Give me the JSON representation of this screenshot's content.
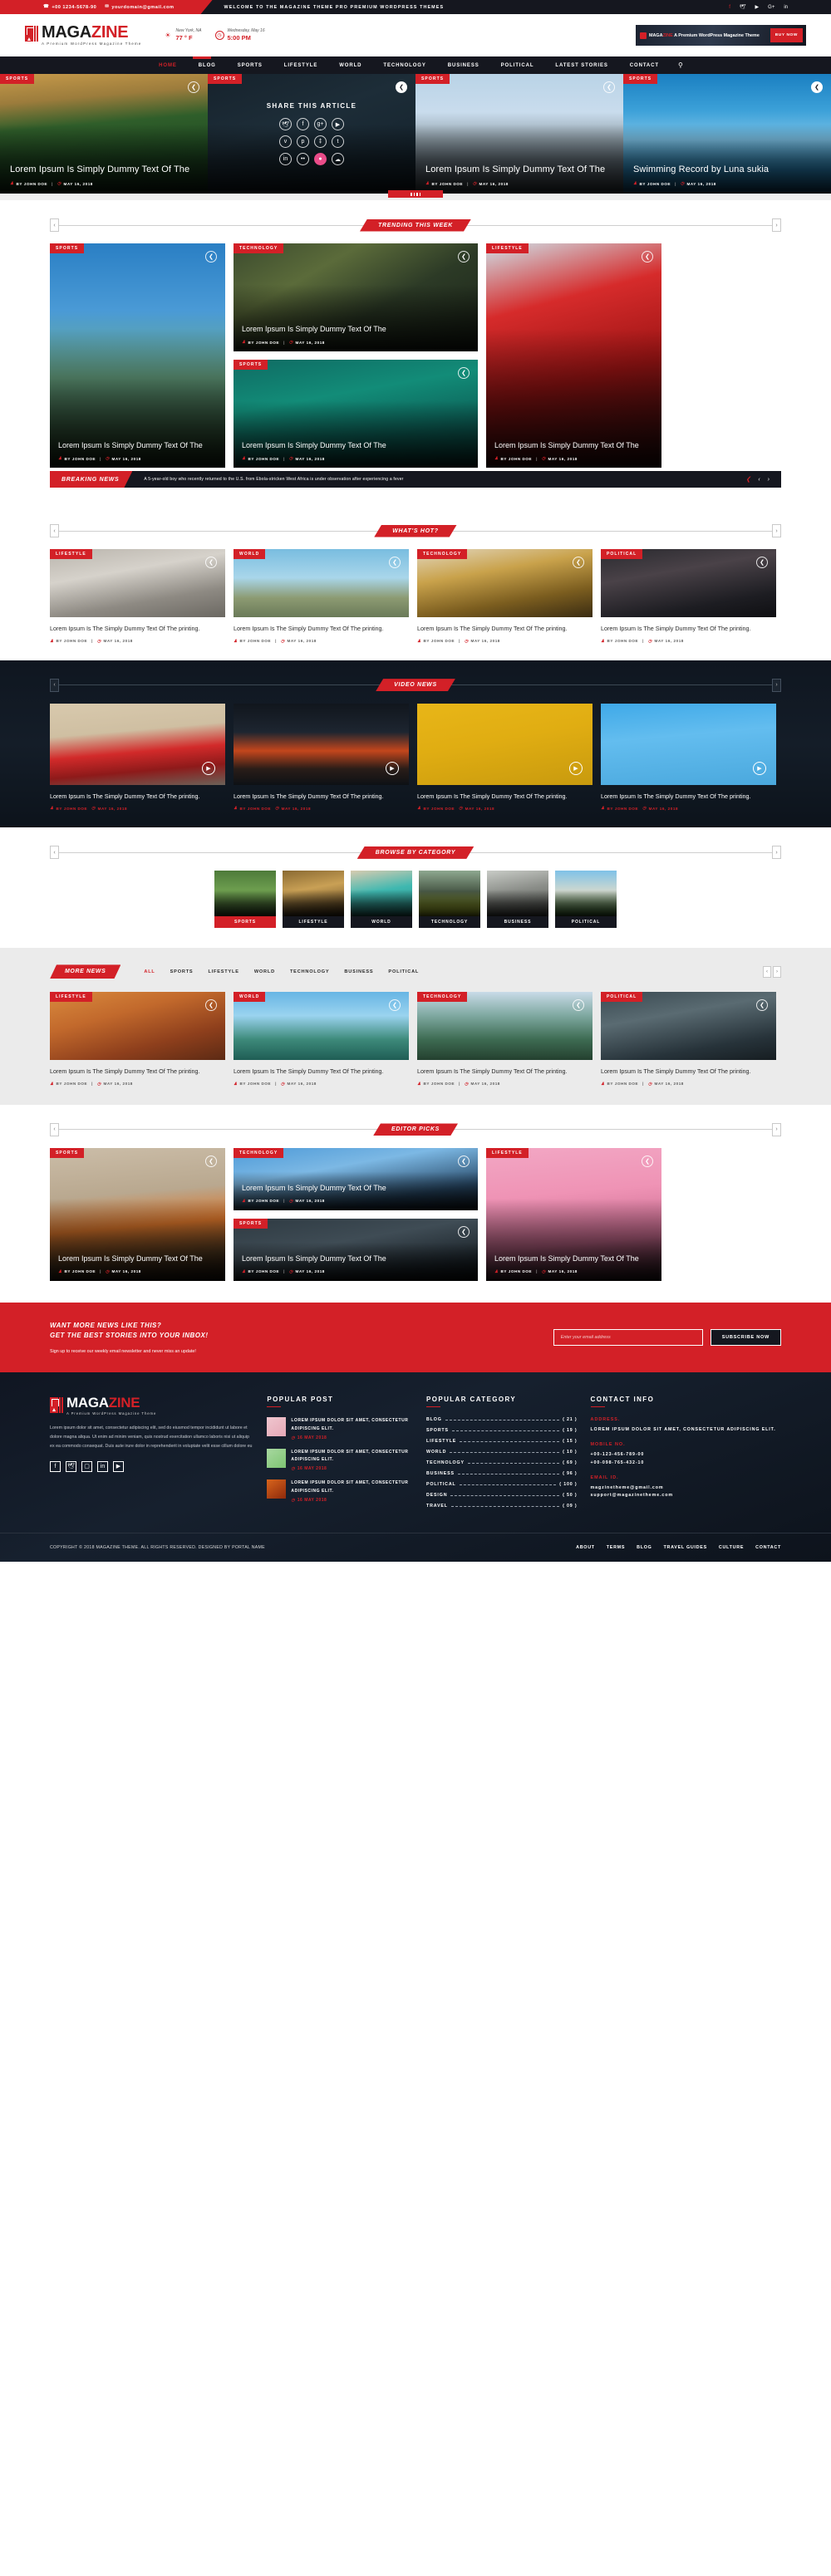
{
  "topbar": {
    "phone": "+00 1234-5678-90",
    "email": "yourdomain@gmail.com",
    "welcome": "WELCOME TO THE MAGAZINE THEME PRO PREMIUM WORDPRESS THEMES",
    "socials": [
      {
        "name": "facebook-icon",
        "glyph": "f"
      },
      {
        "name": "twitter-icon",
        "glyph": "🕊"
      },
      {
        "name": "youtube-icon",
        "glyph": "▶"
      },
      {
        "name": "google-plus-icon",
        "glyph": "G+"
      },
      {
        "name": "linkedin-icon",
        "glyph": "in"
      }
    ]
  },
  "header": {
    "logo_title_dark": "MAGA",
    "logo_title_red": "ZINE",
    "logo_sub": "A Premium WordPress Magazine Theme",
    "weather_location": "New York, NA",
    "weather_temp": "77 ° F",
    "date_label": "Wednesday, May 16",
    "time_label": "5:00 PM",
    "ad_text_1": "MAGA",
    "ad_text_2": "ZINE",
    "ad_text_3": " A Premium WordPress Magazine Theme",
    "ad_button": "BUY NOW"
  },
  "nav": {
    "items": [
      {
        "label": "HOME",
        "active": true
      },
      {
        "label": "BLOG",
        "active": false
      },
      {
        "label": "SPORTS",
        "active": false
      },
      {
        "label": "LIFESTYLE",
        "active": false
      },
      {
        "label": "WORLD",
        "active": false
      },
      {
        "label": "TECHNOLOGY",
        "active": false
      },
      {
        "label": "BUSINESS",
        "active": false
      },
      {
        "label": "POLITICAL",
        "active": false
      },
      {
        "label": "LATEST STORIES",
        "active": false
      },
      {
        "label": "CONTACT",
        "active": false
      }
    ],
    "search_icon": "search-icon"
  },
  "hero": {
    "slides": [
      {
        "category": "SPORTS",
        "title": "Lorem Ipsum Is Simply Dummy Text Of The",
        "author": "BY JOHN DOE",
        "date": "MAY 16, 2018"
      },
      {
        "category": "SPORTS",
        "share_heading": "SHARE THIS ARTICLE"
      },
      {
        "category": "SPORTS",
        "title": "Lorem Ipsum Is Simply Dummy Text Of The",
        "author": "BY JOHN DOE",
        "date": "MAY 16, 2018"
      },
      {
        "category": "SPORTS",
        "title": "Swimming Record by Luna sukia",
        "author": "BY JOHN DOE",
        "date": "MAY 16, 2018"
      }
    ],
    "share_icons": [
      "twitter-icon",
      "facebook-icon",
      "google-plus-icon",
      "youtube-icon",
      "vimeo-icon",
      "pinterest-icon",
      "behance-icon",
      "tumblr-icon",
      "linkedin-icon",
      "flickr-icon",
      "dribbble-icon",
      "rss-icon"
    ]
  },
  "trending": {
    "heading": "TRENDING THIS WEEK",
    "cards": [
      {
        "category": "SPORTS",
        "title": "Lorem Ipsum Is Simply Dummy Text Of The",
        "author": "BY JOHN DOE",
        "date": "MAY 16, 2018"
      },
      {
        "category": "TECHNOLOGY",
        "title": "Lorem Ipsum Is Simply Dummy Text Of The",
        "author": "BY JOHN DOE",
        "date": "MAY 16, 2018"
      },
      {
        "category": "SPORTS",
        "title": "Lorem Ipsum Is Simply Dummy Text Of The",
        "author": "BY JOHN DOE",
        "date": "MAY 16, 2018"
      },
      {
        "category": "LIFESTYLE",
        "title": "Lorem Ipsum Is Simply Dummy Text Of The",
        "author": "BY JOHN DOE",
        "date": "MAY 16, 2018"
      }
    ]
  },
  "breaking": {
    "label": "BREAKING NEWS",
    "text": "A 5-year-old boy who recently returned to the U.S. from Ebola-stricken West Africa is under observation after experiencing a fever"
  },
  "whats_hot": {
    "heading": "WHAT'S HOT?",
    "cards": [
      {
        "category": "LIFESTYLE",
        "title": "Lorem Ipsum Is The Simply Dummy Text Of The printing.",
        "author": "BY JOHN DOE",
        "date": "MAY 16, 2018"
      },
      {
        "category": "WORLD",
        "title": "Lorem Ipsum Is The Simply Dummy Text Of The printing.",
        "author": "BY JOHN DOE",
        "date": "MAY 16, 2018"
      },
      {
        "category": "TECHNOLOGY",
        "title": "Lorem Ipsum Is The Simply Dummy Text Of The printing.",
        "author": "BY JOHN DOE",
        "date": "MAY 16, 2018"
      },
      {
        "category": "POLITICAL",
        "title": "Lorem Ipsum Is The Simply Dummy Text Of The printing.",
        "author": "BY JOHN DOE",
        "date": "MAY 16, 2018"
      }
    ]
  },
  "video_news": {
    "heading": "VIDEO NEWS",
    "cards": [
      {
        "title": "Lorem Ipsum Is The Simply Dummy Text Of The printing.",
        "author": "BY JOHN DOE",
        "date": "MAY 16, 2018"
      },
      {
        "title": "Lorem Ipsum Is The Simply Dummy Text Of The printing.",
        "author": "BY JOHN DOE",
        "date": "MAY 16, 2018"
      },
      {
        "title": "Lorem Ipsum Is The Simply Dummy Text Of The printing.",
        "author": "BY JOHN DOE",
        "date": "MAY 16, 2018"
      },
      {
        "title": "Lorem Ipsum Is The Simply Dummy Text Of The printing.",
        "author": "BY JOHN DOE",
        "date": "MAY 16, 2018"
      }
    ]
  },
  "browse_category": {
    "heading": "BROWSE BY CATEGORY",
    "items": [
      {
        "label": "SPORTS",
        "active": true
      },
      {
        "label": "LIFESTYLE",
        "active": false
      },
      {
        "label": "WORLD",
        "active": false
      },
      {
        "label": "TECHNOLOGY",
        "active": false
      },
      {
        "label": "BUSINESS",
        "active": false
      },
      {
        "label": "POLITICAL",
        "active": false
      }
    ]
  },
  "more_news": {
    "heading": "MORE NEWS",
    "tabs": [
      {
        "label": "ALL",
        "active": true
      },
      {
        "label": "SPORTS",
        "active": false
      },
      {
        "label": "LIFESTYLE",
        "active": false
      },
      {
        "label": "WORLD",
        "active": false
      },
      {
        "label": "TECHNOLOGY",
        "active": false
      },
      {
        "label": "BUSINESS",
        "active": false
      },
      {
        "label": "POLITICAL",
        "active": false
      }
    ],
    "cards": [
      {
        "category": "LIFESTYLE",
        "title": "Lorem Ipsum Is The Simply Dummy Text Of The printing.",
        "author": "BY JOHN DOE",
        "date": "MAY 16, 2018"
      },
      {
        "category": "WORLD",
        "title": "Lorem Ipsum Is The Simply Dummy Text Of The printing.",
        "author": "BY JOHN DOE",
        "date": "MAY 16, 2018"
      },
      {
        "category": "TECHNOLOGY",
        "title": "Lorem Ipsum Is The Simply Dummy Text Of The printing.",
        "author": "BY JOHN DOE",
        "date": "MAY 16, 2018"
      },
      {
        "category": "POLITICAL",
        "title": "Lorem Ipsum Is The Simply Dummy Text Of The printing.",
        "author": "BY JOHN DOE",
        "date": "MAY 16, 2018"
      }
    ]
  },
  "editor_picks": {
    "heading": "EDITOR PICKS",
    "cards": [
      {
        "category": "SPORTS",
        "title": "Lorem Ipsum Is Simply Dummy Text Of The",
        "author": "BY JOHN DOE",
        "date": "MAY 16, 2018"
      },
      {
        "category": "TECHNOLOGY",
        "title": "Lorem Ipsum Is Simply Dummy Text Of The",
        "author": "BY JOHN DOE",
        "date": "MAY 16, 2018"
      },
      {
        "category": "SPORTS",
        "title": "Lorem Ipsum Is Simply Dummy Text Of The",
        "author": "BY JOHN DOE",
        "date": "MAY 16, 2018"
      },
      {
        "category": "LIFESTYLE",
        "title": "Lorem Ipsum Is Simply Dummy Text Of The",
        "author": "BY JOHN DOE",
        "date": "MAY 16, 2018"
      }
    ]
  },
  "newsletter": {
    "line1": "WANT MORE NEWS LIKE THIS?",
    "line2": "GET THE BEST STORIES INTO YOUR INBOX!",
    "note": "Sign up to receive our weekly email newsletter and never miss an update!",
    "placeholder": "Enter your email address",
    "button": "SUBSCRIBE NOW"
  },
  "footer": {
    "logo_title_white": "MAGA",
    "logo_title_red": "ZINE",
    "logo_sub": "A Premium WordPress Magazine Theme",
    "about": "Lorem ipsum dolor sit amet, consectetur adipiscing elit, sed do eiusmod tempor incididunt ut labore et dolore magna aliqua. Ut enim ad minim veniam, quis nostrud exercitation ullamco laboris nisi ut aliquip ex ea commodo consequat. Duis aute irure dolor in reprehenderit in voluptate velit esse cillum dolore eu",
    "socials": [
      {
        "name": "facebook-icon",
        "glyph": "f"
      },
      {
        "name": "twitter-icon",
        "glyph": "🕊"
      },
      {
        "name": "instagram-icon",
        "glyph": "▢"
      },
      {
        "name": "linkedin-icon",
        "glyph": "in"
      },
      {
        "name": "youtube-icon",
        "glyph": "▶"
      }
    ],
    "popular_post_heading": "POPULAR POST",
    "popular_posts": [
      {
        "title": "LOREM IPSUM DOLOR SIT AMET, CONSECTETUR ADIPISCING ELIT.",
        "date": "16 MAY 2018"
      },
      {
        "title": "LOREM IPSUM DOLOR SIT AMET, CONSECTETUR ADIPISCING ELIT.",
        "date": "16 MAY 2018"
      },
      {
        "title": "LOREM IPSUM DOLOR SIT AMET, CONSECTETUR ADIPISCING ELIT.",
        "date": "16 MAY 2018"
      }
    ],
    "popular_category_heading": "POPULAR CATEGORY",
    "popular_categories": [
      {
        "label": "BLOG",
        "count": "( 21 )"
      },
      {
        "label": "SPORTS",
        "count": "( 19 )"
      },
      {
        "label": "LIFESTYLE",
        "count": "( 15 )"
      },
      {
        "label": "WORLD",
        "count": "( 10 )"
      },
      {
        "label": "TECHNOLOGY",
        "count": "( 69 )"
      },
      {
        "label": "BUSINESS",
        "count": "( 96 )"
      },
      {
        "label": "POLITICAL",
        "count": "( 100 )"
      },
      {
        "label": "DESIGN",
        "count": "( 50 )"
      },
      {
        "label": "TRAVEL",
        "count": "( 09 )"
      }
    ],
    "contact_heading": "CONTACT INFO",
    "address_label": "ADDRESS.",
    "address_value": "LOREM IPSUM DOLOR SIT AMET, CONSECTETUR ADIPISCING ELIT.",
    "mobile_label": "MOBILE NO.",
    "mobile_1": "+00-123-456-789-00",
    "mobile_2": "+00-098-765-432-10",
    "email_label": "EMAIL ID.",
    "email_1": "magzinetheme@gmail.com",
    "email_2": "support@magazinetheme.com",
    "copyright": "COPYRIGHT © 2018 MAGAZINE THEME. ALL RIGHTS RESERVED. DESIGNED BY PORTAL NAME",
    "links": [
      {
        "label": "ABOUT"
      },
      {
        "label": "TERMS"
      },
      {
        "label": "BLOG"
      },
      {
        "label": "TRAVEL GUIDES"
      },
      {
        "label": "CULTURE"
      },
      {
        "label": "CONTACT"
      }
    ]
  },
  "colors": {
    "accent": "#d32027",
    "dark": "#15171f",
    "pink": "#ea4c89"
  }
}
